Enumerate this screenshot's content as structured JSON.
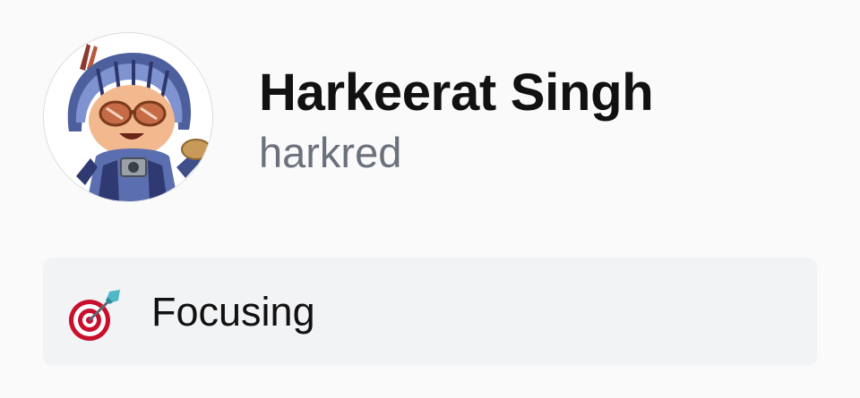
{
  "profile": {
    "display_name": "Harkeerat Singh",
    "username": "harkred",
    "avatar_icon": "octocat-knight-avatar"
  },
  "status": {
    "emoji_icon": "direct-hit-target-icon",
    "text": "Focusing"
  },
  "colors": {
    "background": "#fafafb",
    "card_background": "#f2f3f5",
    "name_text": "#111111",
    "username_text": "#6b717b"
  }
}
